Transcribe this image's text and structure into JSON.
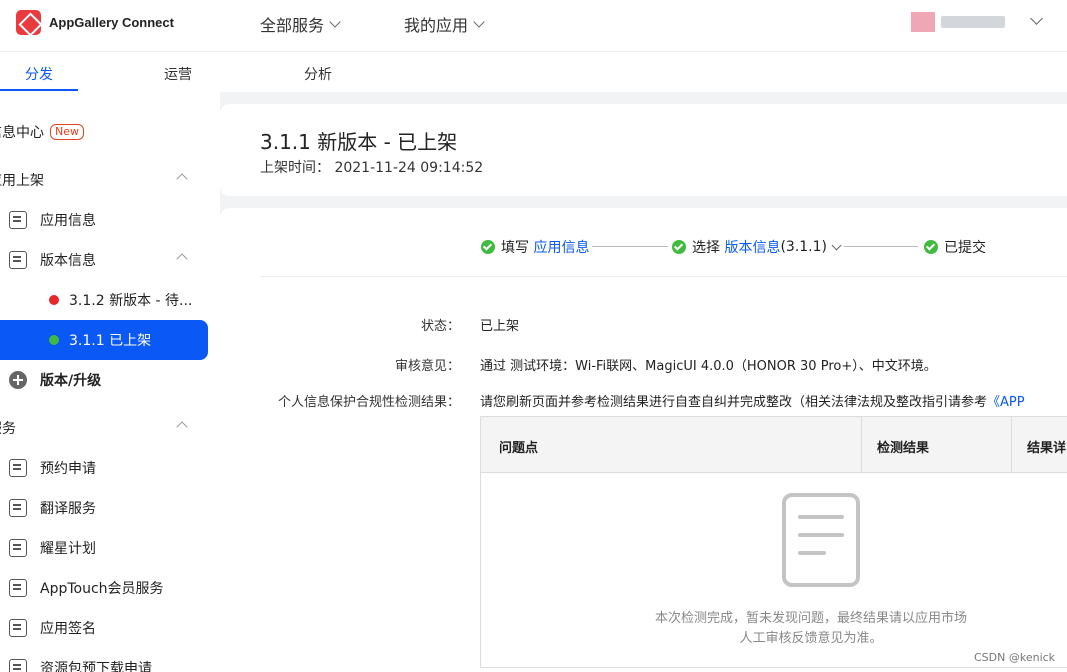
{
  "header": {
    "brand_name": "AppGallery Connect",
    "nav_all_services": "全部服务",
    "nav_my_apps": "我的应用"
  },
  "tabs": [
    {
      "label": "分发",
      "active": true
    },
    {
      "label": "运营",
      "active": false
    },
    {
      "label": "分析",
      "active": false
    }
  ],
  "sidebar": {
    "message_center": "信息中心",
    "new_badge": "New",
    "section_publish": "应用上架",
    "app_info": "应用信息",
    "version_info": "版本信息",
    "version_312": "3.1.2 新版本 - 待...",
    "version_311": "3.1.1 已上架",
    "version_upgrade": "版本/升级",
    "section_services": "服务",
    "services": [
      "预约申请",
      "翻译服务",
      "耀星计划",
      "AppTouch会员服务",
      "应用签名",
      "资源包预下载申请"
    ]
  },
  "page": {
    "title": "3.1.1 新版本 - 已上架",
    "published_label": "上架时间：",
    "published_time": "2021-11-24 09:14:52"
  },
  "steps": {
    "step1_prefix": "填写",
    "step1_link": "应用信息",
    "step2_prefix": "选择",
    "step2_link": "版本信息",
    "step2_version": "(3.1.1)",
    "step3": "已提交"
  },
  "fields": {
    "status_label": "状态：",
    "status_value": "已上架",
    "review_label": "审核意见：",
    "review_value": "通过 测试环境：Wi-Fi联网、MagicUI 4.0.0（HONOR 30 Pro+）、中文环境。",
    "privacy_label": "个人信息保护合规性检测结果：",
    "privacy_value": "请您刷新页面并参考检测结果进行自查自纠并完成整改（相关法律法规及整改指引请参考",
    "privacy_link": "《APP"
  },
  "table": {
    "col_issue": "问题点",
    "col_result": "检测结果",
    "col_detail": "结果详",
    "empty_line1": "本次检测完成，暂未发现问题，最终结果请以应用市场",
    "empty_line2": "人工审核反馈意见为准。"
  },
  "watermark": "CSDN @kenick",
  "colors": {
    "accent": "#0a59f7",
    "success": "#41ba41",
    "danger": "#e83a3f"
  }
}
